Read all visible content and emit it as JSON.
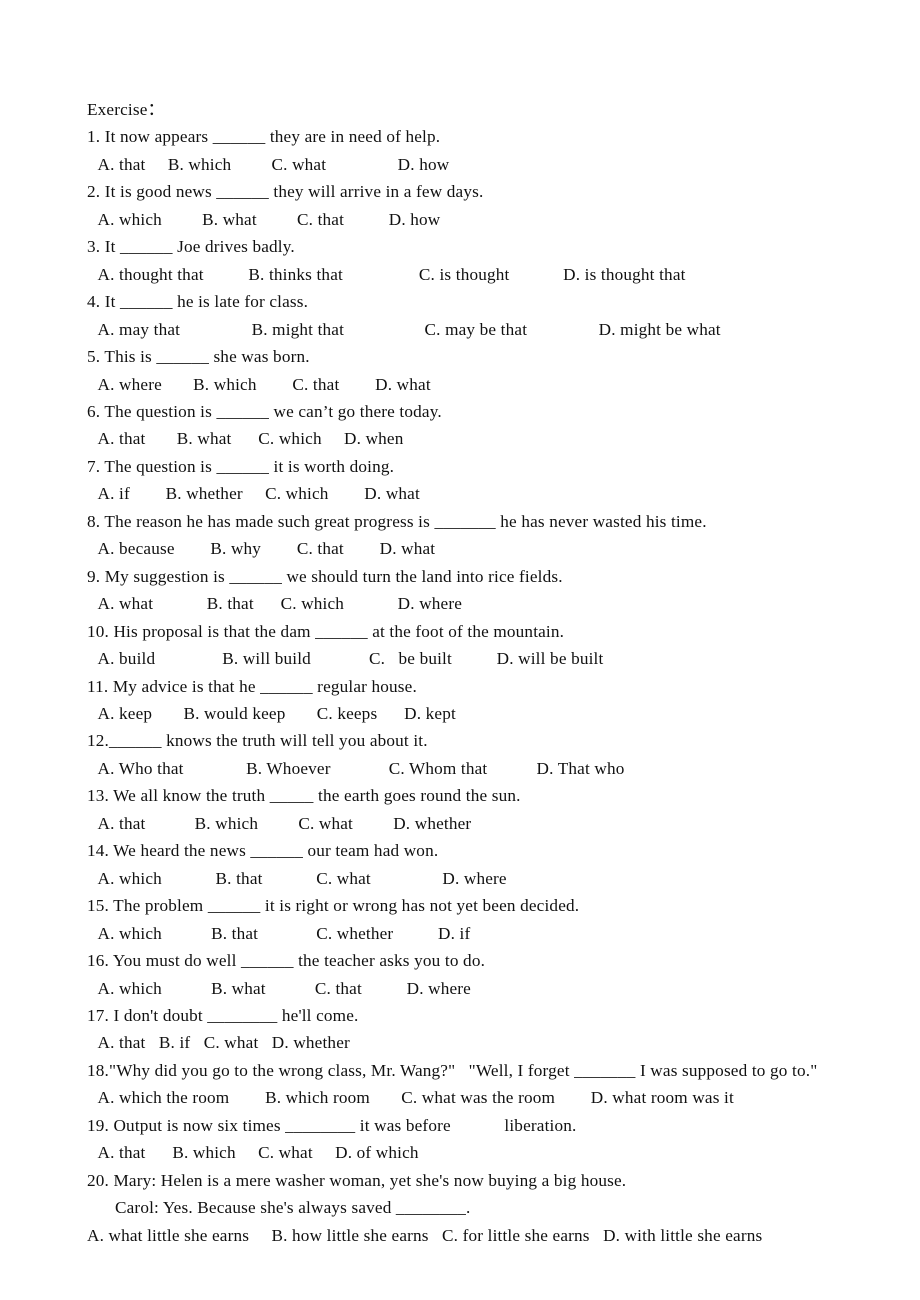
{
  "document": {
    "heading": "Exercise：",
    "lines": [
      {
        "kind": "question",
        "text": "1. It now appears ______ they are in need of help."
      },
      {
        "kind": "options",
        "text": " A. that     B. which         C. what                D. how"
      },
      {
        "kind": "question",
        "text": "2. It is good news ______ they will arrive in a few days."
      },
      {
        "kind": "options",
        "text": " A. which         B. what         C. that          D. how"
      },
      {
        "kind": "question",
        "text": "3. It ______ Joe drives badly."
      },
      {
        "kind": "options",
        "text": " A. thought that          B. thinks that                 C. is thought            D. is thought that"
      },
      {
        "kind": "question",
        "text": "4. It ______ he is late for class."
      },
      {
        "kind": "options",
        "text": " A. may that                B. might that                  C. may be that                D. might be what"
      },
      {
        "kind": "question",
        "text": "5. This is ______ she was born."
      },
      {
        "kind": "options",
        "text": " A. where       B. which        C. that        D. what"
      },
      {
        "kind": "question",
        "text": "6. The question is ______ we can’t go there today."
      },
      {
        "kind": "options",
        "text": " A. that       B. what      C. which     D. when"
      },
      {
        "kind": "question",
        "text": "7. The question is ______ it is worth doing."
      },
      {
        "kind": "options",
        "text": " A. if        B. whether     C. which        D. what"
      },
      {
        "kind": "question",
        "text": "8. The reason he has made such great progress is _______ he has never wasted his time."
      },
      {
        "kind": "options",
        "text": " A. because        B. why        C. that        D. what"
      },
      {
        "kind": "question",
        "text": "9. My suggestion is ______ we should turn the land into rice fields."
      },
      {
        "kind": "options",
        "text": " A. what            B. that      C. which            D. where"
      },
      {
        "kind": "question",
        "text": "10. His proposal is that the dam ______ at the foot of the mountain."
      },
      {
        "kind": "options",
        "text": " A. build               B. will build             C.   be built          D. will be built"
      },
      {
        "kind": "question",
        "text": "11. My advice is that he ______ regular house."
      },
      {
        "kind": "options",
        "text": " A. keep       B. would keep       C. keeps      D. kept"
      },
      {
        "kind": "question",
        "text": "12.______ knows the truth will tell you about it."
      },
      {
        "kind": "options",
        "text": " A. Who that              B. Whoever             C. Whom that           D. That who"
      },
      {
        "kind": "question",
        "text": "13. We all know the truth _____ the earth goes round the sun."
      },
      {
        "kind": "options",
        "text": " A. that           B. which         C. what         D. whether"
      },
      {
        "kind": "question",
        "text": "14. We heard the news ______ our team had won."
      },
      {
        "kind": "options",
        "text": " A. which            B. that            C. what                D. where"
      },
      {
        "kind": "question",
        "text": "15. The problem ______ it is right or wrong has not yet been decided."
      },
      {
        "kind": "options",
        "text": " A. which           B. that             C. whether          D. if"
      },
      {
        "kind": "question",
        "text": "16. You must do well ______ the teacher asks you to do."
      },
      {
        "kind": "options",
        "text": " A. which           B. what           C. that          D. where"
      },
      {
        "kind": "question",
        "text": "17. I don't doubt ________ he'll come."
      },
      {
        "kind": "options",
        "text": " A. that   B. if   C. what   D. whether"
      },
      {
        "kind": "question",
        "text": "18.\"Why did you go to the wrong class, Mr. Wang?\"   \"Well, I forget _______ I was supposed to go to.\""
      },
      {
        "kind": "options",
        "text": " A. which the room        B. which room       C. what was the room        D. what room was it"
      },
      {
        "kind": "question",
        "text": "19. Output is now six times ________ it was before            liberation."
      },
      {
        "kind": "options",
        "text": " A. that      B. which     C. what     D. of which"
      },
      {
        "kind": "question",
        "text": "20. Mary: Helen is a mere washer woman, yet she's now buying a big house."
      },
      {
        "kind": "dialog",
        "text": "Carol: Yes. Because she's always saved ________."
      },
      {
        "kind": "options-flush",
        "text": "A. what little she earns     B. how little she earns   C. for little she earns   D. with little she earns"
      }
    ]
  }
}
